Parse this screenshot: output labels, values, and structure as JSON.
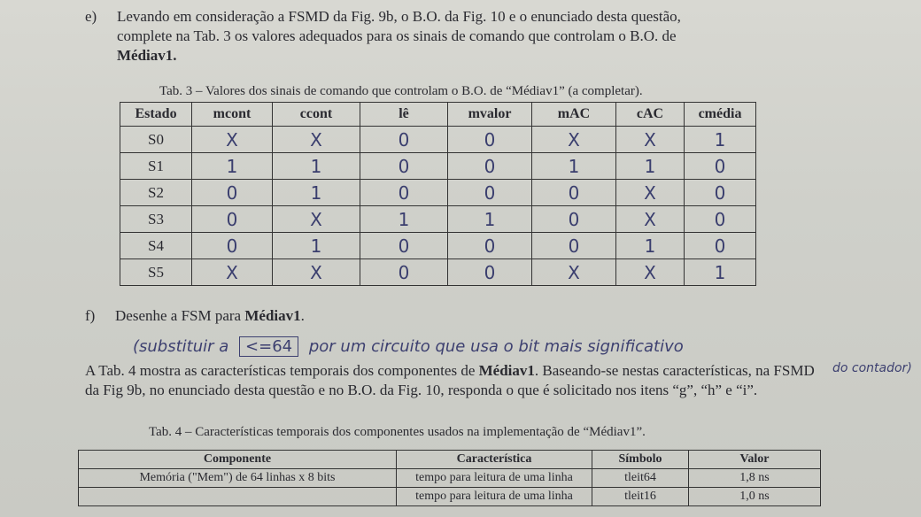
{
  "question_e": {
    "label": "e)",
    "line1": "Levando em consideração a FSMD da Fig. 9b, o B.O. da Fig. 10 e o enunciado desta questão,",
    "line2": "complete na Tab. 3 os valores adequados para os sinais de comando que controlam o B.O. de",
    "line3": "Médiav1."
  },
  "tab3": {
    "caption": "Tab. 3 – Valores dos sinais de comando que controlam o B.O. de “Médiav1” (a completar).",
    "headers": [
      "Estado",
      "mcont",
      "ccont",
      "lê",
      "mvalor",
      "mAC",
      "cAC",
      "cmédia"
    ],
    "rows": [
      [
        "S0",
        "X",
        "X",
        "0",
        "0",
        "X",
        "X",
        "1"
      ],
      [
        "S1",
        "1",
        "1",
        "0",
        "0",
        "1",
        "1",
        "0"
      ],
      [
        "S2",
        "0",
        "1",
        "0",
        "0",
        "0",
        "X",
        "0"
      ],
      [
        "S3",
        "0",
        "X",
        "1",
        "1",
        "0",
        "X",
        "0"
      ],
      [
        "S4",
        "0",
        "1",
        "0",
        "0",
        "0",
        "1",
        "0"
      ],
      [
        "S5",
        "X",
        "X",
        "0",
        "0",
        "X",
        "X",
        "1"
      ]
    ]
  },
  "question_f": {
    "label": "f)",
    "text": "Desenhe a FSM para ",
    "bold": "Médiav1",
    "end": "."
  },
  "handwritten_note": {
    "part1": "(substituir a",
    "box": "<=64",
    "part2": "por um circuito que usa o bit mais significativo",
    "part3": "do contador)"
  },
  "paragraph": {
    "part1": "A Tab. 4 mostra as características temporais dos componentes de ",
    "bold": "Médiav1",
    "part2": ". Baseando-se nestas características, na FSMD da Fig 9b, no enunciado desta questão e no B.O. da Fig. 10, responda o que é solicitado nos itens “g”, “h” e “i”."
  },
  "tab4": {
    "caption": "Tab. 4 – Características temporais dos componentes usados na implementação de “Médiav1”.",
    "headers": [
      "Componente",
      "Característica",
      "Símbolo",
      "Valor"
    ],
    "rows": [
      [
        "Memória (\"Mem\") de 64 linhas x 8 bits",
        "tempo para leitura de uma linha",
        "tleit64",
        "1,8 ns"
      ],
      [
        "",
        "tempo para leitura de uma linha",
        "tleit16",
        "1,0 ns"
      ]
    ]
  }
}
